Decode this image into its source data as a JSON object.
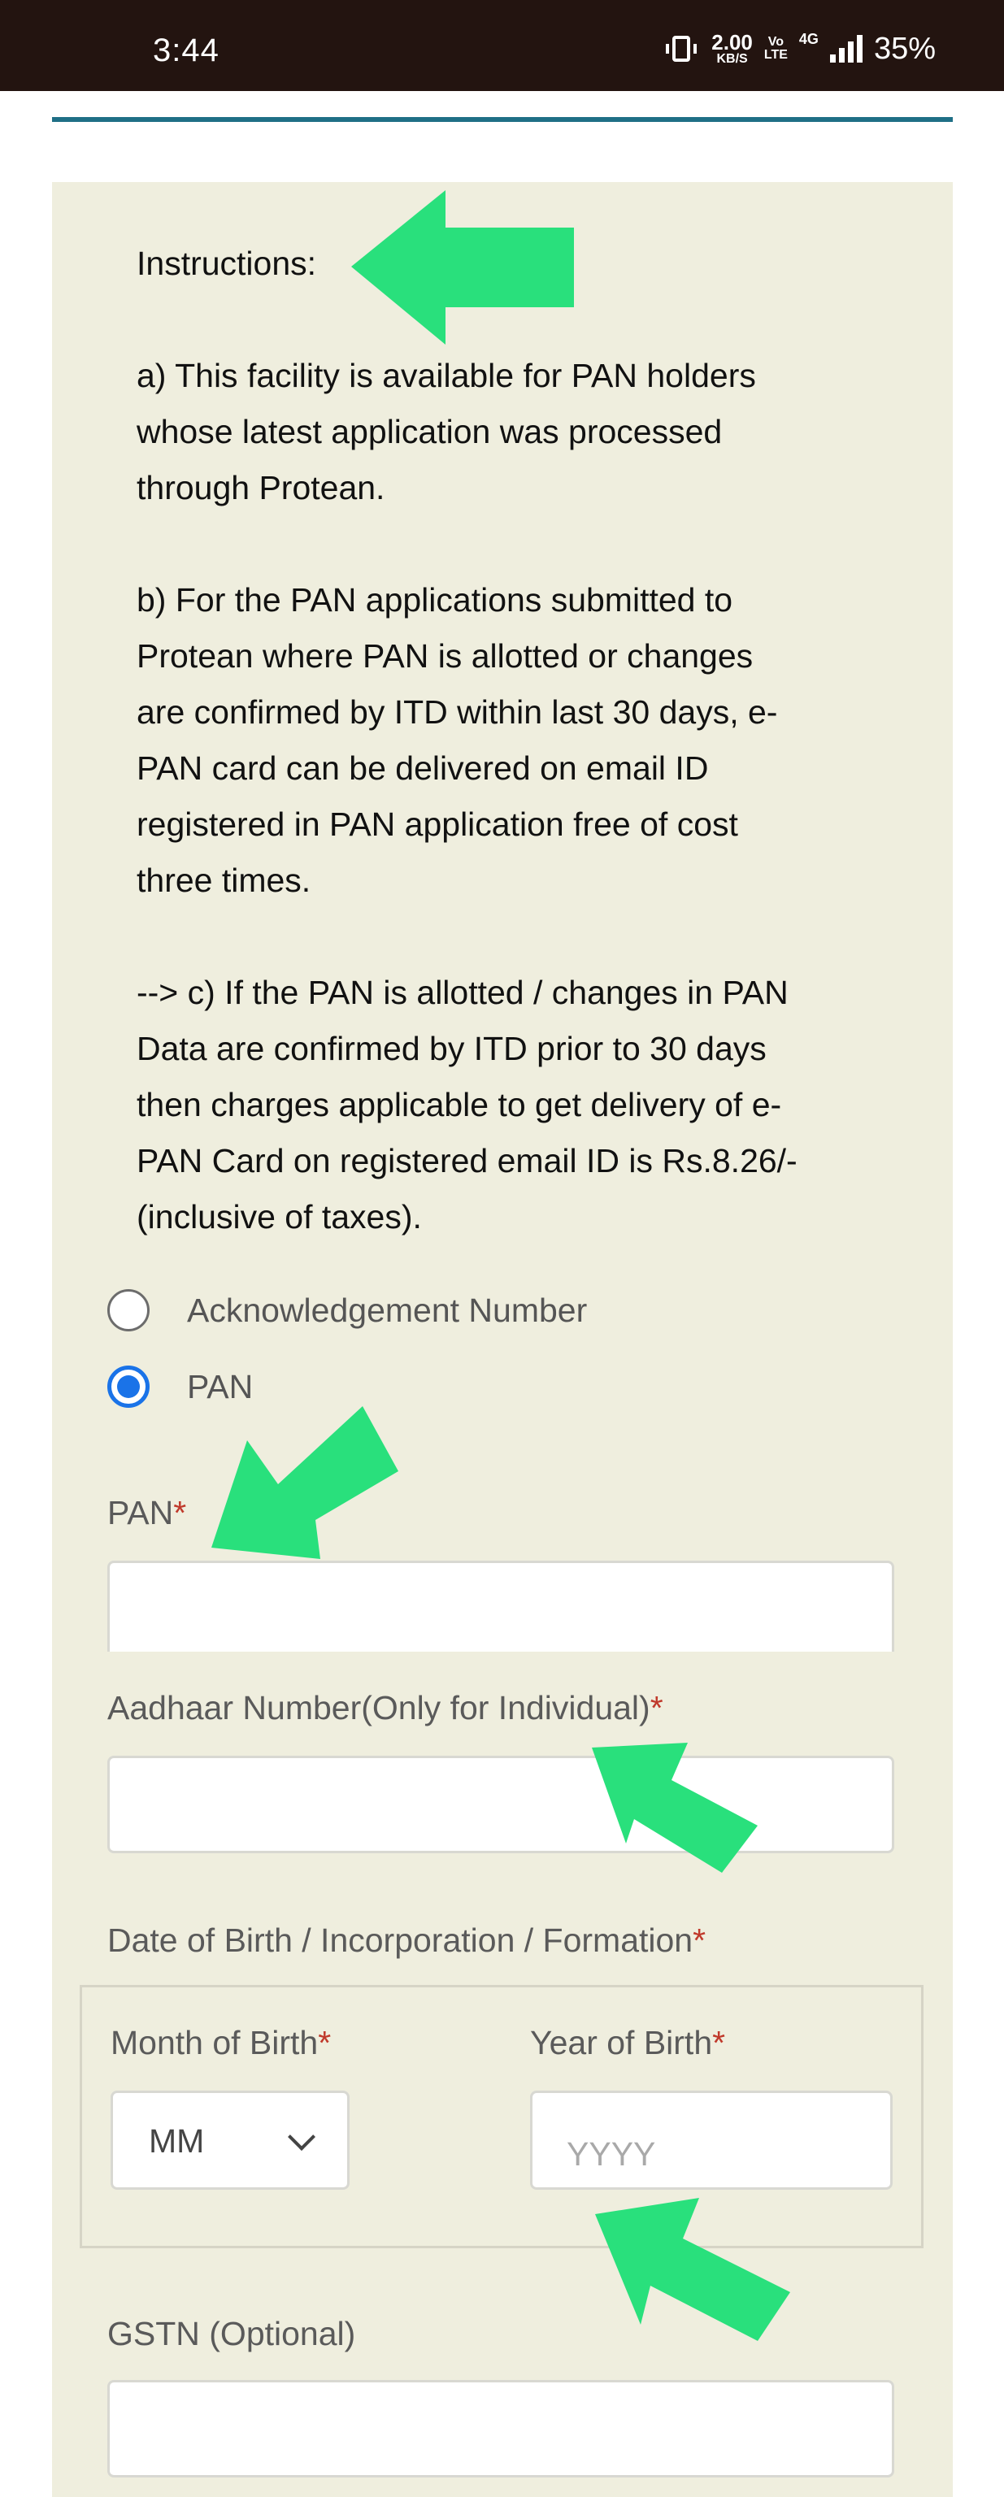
{
  "status_bar": {
    "time": "3:44",
    "speed_value": "2.00",
    "speed_unit": "KB/S",
    "volte_top": "Vo",
    "volte_bottom": "LTE",
    "network": "4G",
    "battery": "35%"
  },
  "instructions": {
    "title": "Instructions:",
    "items": [
      "a) This facility is available for PAN holders\nwhose latest application was processed\nthrough Protean.",
      "b) For the PAN applications submitted to\nProtean where PAN is allotted or changes\nare confirmed by ITD within last 30 days, e-\nPAN card can be delivered on email ID\nregistered in PAN application free of cost\nthree times.",
      "--> c) If the PAN is allotted / changes in PAN\nData are confirmed by ITD prior to 30 days\nthen charges applicable to get delivery of e-\nPAN Card on registered email ID is Rs.8.26/-\n(inclusive of taxes)."
    ]
  },
  "options": {
    "ack_label": "Acknowledgement Number",
    "pan_label": "PAN",
    "selected": "PAN"
  },
  "form": {
    "required_mark": "*",
    "pan_label": "PAN",
    "aadhaar_label": "Aadhaar Number(Only for Individual)",
    "dob_label": "Date of Birth / Incorporation / Formation",
    "month_label": "Month of Birth",
    "month_value": "MM",
    "year_label": "Year of Birth",
    "year_placeholder": "YYYY",
    "gstn_label": "GSTN (Optional)"
  },
  "colors": {
    "status_bar": "#231410",
    "panel": "#efeede",
    "rule": "#1f6f86",
    "radio_selected": "#1a73e8",
    "required": "#c0392b",
    "annotation_arrow": "#29e07c"
  },
  "icons": [
    "vibrate-icon",
    "signal-icon",
    "chevron-down-icon",
    "arrow-annotation"
  ]
}
